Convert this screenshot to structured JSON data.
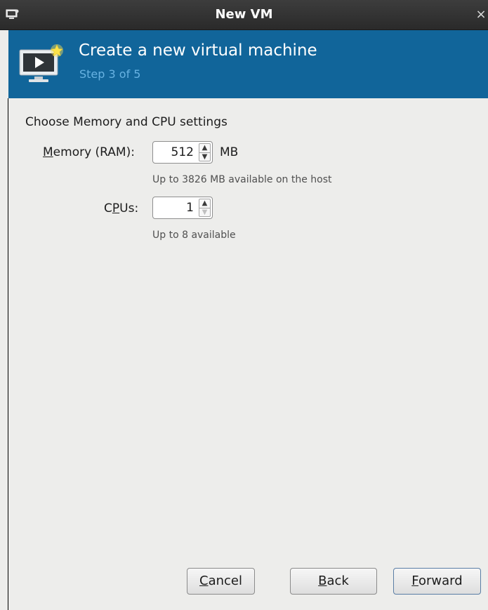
{
  "window": {
    "title": "New VM",
    "close_glyph": "×",
    "icon": "computer-icon"
  },
  "banner": {
    "title": "Create a new virtual machine",
    "step": "Step 3 of 5",
    "icon": "virtual-machine-icon",
    "background_color": "#11659a",
    "step_color": "#67b2e2"
  },
  "section": {
    "heading": "Choose Memory and CPU settings"
  },
  "memory": {
    "label_mnemonic": "M",
    "label_rest": "emory (RAM):",
    "value": "512",
    "unit": "MB",
    "hint": "Up to 3826 MB available on the host"
  },
  "cpus": {
    "label_pre": "C",
    "label_mnemonic": "P",
    "label_rest": "Us:",
    "value": "1",
    "hint": "Up to 8 available"
  },
  "buttons": {
    "cancel_mnemonic": "C",
    "cancel_rest": "ancel",
    "back_mnemonic": "B",
    "back_rest": "ack",
    "forward_mnemonic": "F",
    "forward_rest": "orward"
  }
}
